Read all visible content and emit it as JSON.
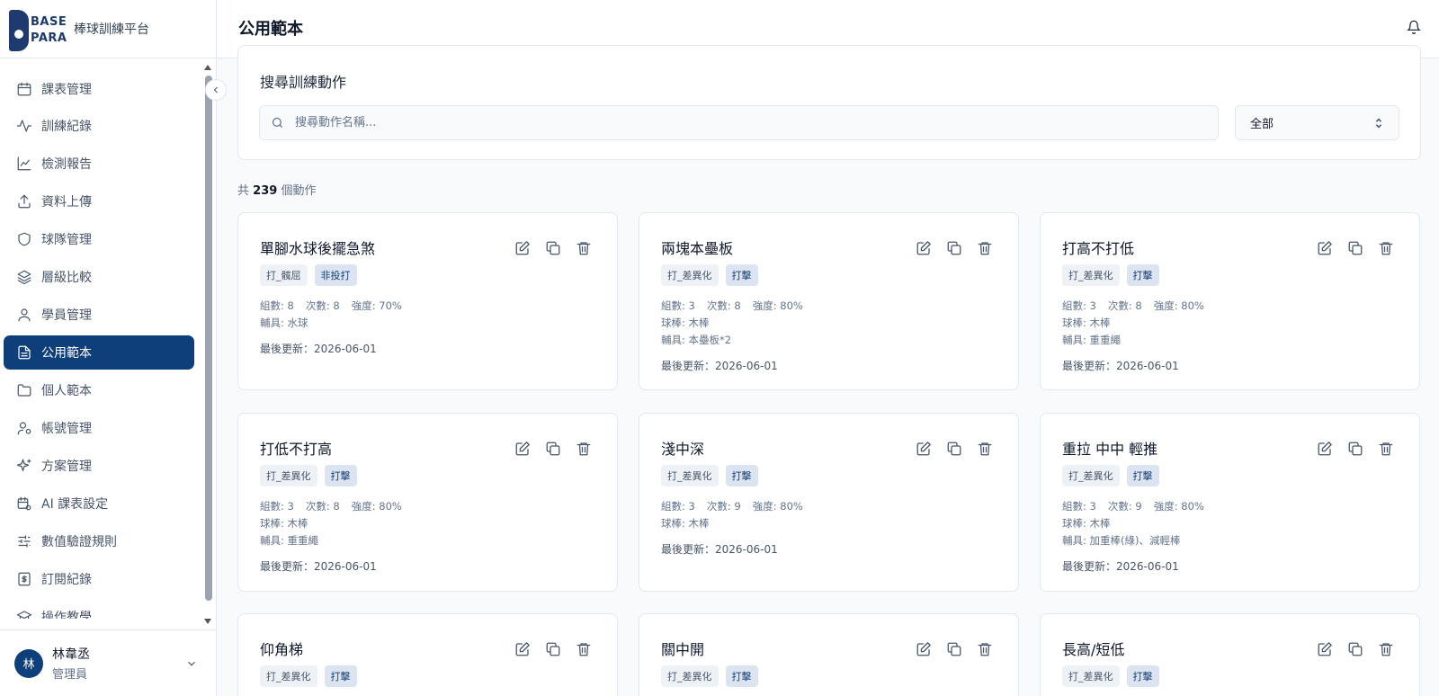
{
  "brand": {
    "logo_line1": "BASE",
    "logo_line2": "PARA",
    "platform_name": "棒球訓練平台"
  },
  "header": {
    "title": "公用範本"
  },
  "sidebar": {
    "items": [
      {
        "label": "課表管理",
        "icon": "calendar-icon"
      },
      {
        "label": "訓練紀錄",
        "icon": "activity-icon"
      },
      {
        "label": "檢測報告",
        "icon": "line-chart-icon"
      },
      {
        "label": "資料上傳",
        "icon": "upload-icon"
      },
      {
        "label": "球隊管理",
        "icon": "shield-icon"
      },
      {
        "label": "層級比較",
        "icon": "layers-icon"
      },
      {
        "label": "學員管理",
        "icon": "user-icon"
      },
      {
        "label": "公用範本",
        "icon": "file-text-icon",
        "active": true
      },
      {
        "label": "個人範本",
        "icon": "folder-icon"
      },
      {
        "label": "帳號管理",
        "icon": "user-cog-icon"
      },
      {
        "label": "方案管理",
        "icon": "sparkles-icon"
      },
      {
        "label": "AI 課表設定",
        "icon": "calendar-cog-icon"
      },
      {
        "label": "數值驗證規則",
        "icon": "sliders-icon"
      },
      {
        "label": "訂閱紀錄",
        "icon": "receipt-icon"
      },
      {
        "label": "操作教學",
        "icon": "graduation-cap-icon"
      }
    ]
  },
  "user": {
    "avatar": "林",
    "name": "林韋丞",
    "role": "管理員"
  },
  "search": {
    "title": "搜尋訓練動作",
    "placeholder": "搜尋動作名稱...",
    "filter_value": "全部"
  },
  "count": {
    "prefix": "共",
    "value": "239",
    "suffix": "個動作"
  },
  "cards": [
    {
      "title": "單腳水球後擺急煞",
      "tags": [
        "打_髖屈",
        "非投打"
      ],
      "sets": "組數: 8",
      "reps": "次數: 8",
      "intensity": "強度: 70%",
      "lines": [
        "輔具: 水球"
      ],
      "updated": "最後更新：2026-06-01"
    },
    {
      "title": "兩塊本壘板",
      "tags": [
        "打_差異化",
        "打擊"
      ],
      "sets": "組數: 3",
      "reps": "次數: 8",
      "intensity": "強度: 80%",
      "lines": [
        "球棒: 木棒",
        "輔具: 本壘板*2"
      ],
      "updated": "最後更新：2026-06-01"
    },
    {
      "title": "打高不打低",
      "tags": [
        "打_差異化",
        "打擊"
      ],
      "sets": "組數: 3",
      "reps": "次數: 8",
      "intensity": "強度: 80%",
      "lines": [
        "球棒: 木棒",
        "輔具: 重重繩"
      ],
      "updated": "最後更新：2026-06-01"
    },
    {
      "title": "打低不打高",
      "tags": [
        "打_差異化",
        "打擊"
      ],
      "sets": "組數: 3",
      "reps": "次數: 8",
      "intensity": "強度: 80%",
      "lines": [
        "球棒: 木棒",
        "輔具: 重重繩"
      ],
      "updated": "最後更新：2026-06-01"
    },
    {
      "title": "淺中深",
      "tags": [
        "打_差異化",
        "打擊"
      ],
      "sets": "組數: 3",
      "reps": "次數: 9",
      "intensity": "強度: 80%",
      "lines": [
        "球棒: 木棒"
      ],
      "updated": "最後更新：2026-06-01"
    },
    {
      "title": "重拉 中中 輕推",
      "tags": [
        "打_差異化",
        "打擊"
      ],
      "sets": "組數: 3",
      "reps": "次數: 9",
      "intensity": "強度: 80%",
      "lines": [
        "球棒: 木棒",
        "輔具: 加重棒(綠)、減輕棒"
      ],
      "updated": "最後更新：2026-06-01"
    },
    {
      "title": "仰角梯",
      "tags": [
        "打_差異化",
        "打擊"
      ]
    },
    {
      "title": "關中開",
      "tags": [
        "打_差異化",
        "打擊"
      ]
    },
    {
      "title": "長高/短低",
      "tags": [
        "打_差異化",
        "打擊"
      ]
    }
  ]
}
